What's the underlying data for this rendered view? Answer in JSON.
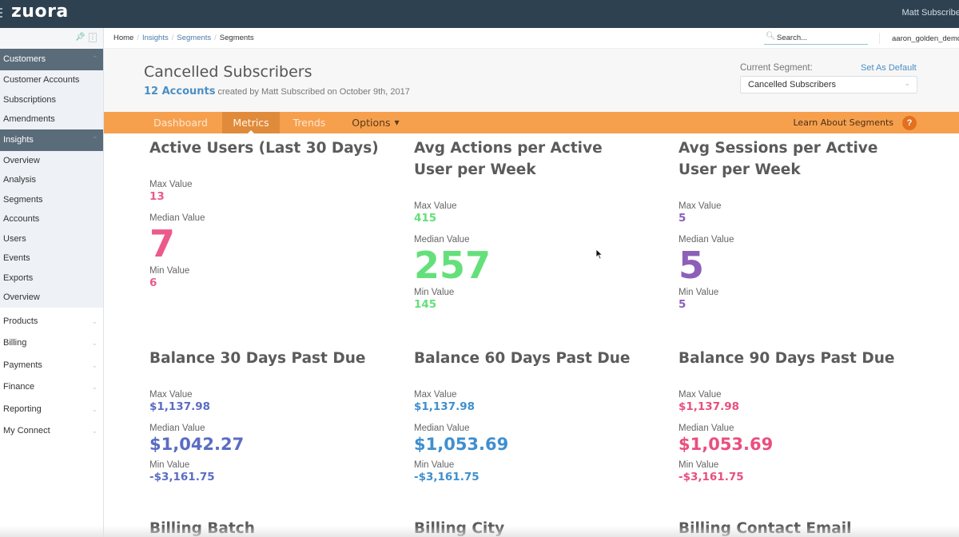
{
  "app": {
    "logo": "zuora",
    "user_name": "Matt Subscribed",
    "tenant": "aaron_golden_demo"
  },
  "breadcrumb": [
    "Home",
    "Insights",
    "Segments",
    "Segments"
  ],
  "search": {
    "placeholder": "Search..."
  },
  "sidebar": {
    "sections": [
      {
        "label": "Customers",
        "items": [
          "Customer Accounts",
          "Subscriptions",
          "Amendments"
        ]
      },
      {
        "label": "Insights",
        "items": [
          "Overview",
          "Analysis",
          "Segments",
          "Accounts",
          "Users",
          "Events",
          "Exports",
          "Overview"
        ]
      }
    ],
    "collapsed": [
      "Products",
      "Billing",
      "Payments",
      "Finance",
      "Reporting",
      "My Connect"
    ]
  },
  "header": {
    "title": "Cancelled Subscribers",
    "account_count": "12 Accounts",
    "created_by": "created by Matt Subscribed on October 9th, 2017",
    "current_segment_label": "Current Segment:",
    "set_default": "Set As Default",
    "current_segment_value": "Cancelled Subscribers"
  },
  "tabs": {
    "items": [
      "Dashboard",
      "Metrics",
      "Trends",
      "Options"
    ],
    "active": "Metrics",
    "learn": "Learn About Segments",
    "help": "?"
  },
  "labels": {
    "max": "Max Value",
    "median": "Median Value",
    "min": "Min Value"
  },
  "metrics": [
    {
      "title": "Active Users (Last 30 Days)",
      "max": "13",
      "median": "7",
      "min": "6",
      "color": "#ec5a8b"
    },
    {
      "title": "Avg Actions per Active User per Week",
      "max": "415",
      "median": "257",
      "min": "145",
      "color": "#64e07a"
    },
    {
      "title": "Avg Sessions per Active User per Week",
      "max": "5",
      "median": "5",
      "min": "5",
      "color": "#8c5fb8"
    },
    {
      "title": "Balance 30 Days Past Due",
      "max": "$1,137.98",
      "median": "$1,042.27",
      "min": "-$3,161.75",
      "color": "#5b6cc4"
    },
    {
      "title": "Balance 60 Days Past Due",
      "max": "$1,137.98",
      "median": "$1,053.69",
      "min": "-$3,161.75",
      "color": "#3f8fcf"
    },
    {
      "title": "Balance 90 Days Past Due",
      "max": "$1,137.98",
      "median": "$1,053.69",
      "min": "-$3,161.75",
      "color": "#e94f7e"
    },
    {
      "title": "Billing Batch"
    },
    {
      "title": "Billing City"
    },
    {
      "title": "Billing Contact Email"
    }
  ]
}
